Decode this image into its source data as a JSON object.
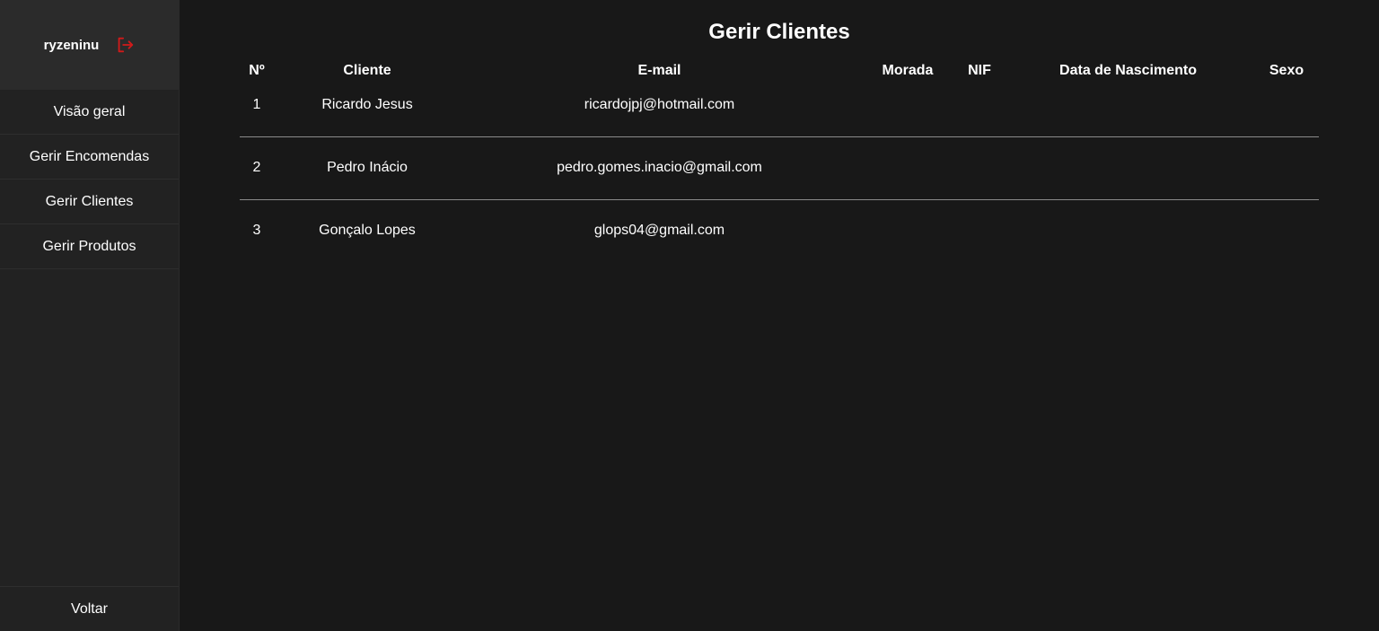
{
  "sidebar": {
    "username": "ryzeninu",
    "logout_icon": "logout-icon",
    "accent_color": "#d11a1a",
    "items": [
      {
        "label": "Visão geral"
      },
      {
        "label": "Gerir Encomendas"
      },
      {
        "label": "Gerir Clientes"
      },
      {
        "label": "Gerir Produtos"
      }
    ],
    "back_label": "Voltar"
  },
  "main": {
    "title": "Gerir Clientes",
    "table": {
      "headers": [
        "Nº",
        "Cliente",
        "E-mail",
        "Morada",
        "NIF",
        "Data de Nascimento",
        "Sexo"
      ],
      "rows": [
        {
          "num": "1",
          "cliente": "Ricardo Jesus",
          "email": "ricardojpj@hotmail.com",
          "morada": "",
          "nif": "",
          "data_nascimento": "",
          "sexo": ""
        },
        {
          "num": "2",
          "cliente": "Pedro Inácio",
          "email": "pedro.gomes.inacio@gmail.com",
          "morada": "",
          "nif": "",
          "data_nascimento": "",
          "sexo": ""
        },
        {
          "num": "3",
          "cliente": "Gonçalo Lopes",
          "email": "glops04@gmail.com",
          "morada": "",
          "nif": "",
          "data_nascimento": "",
          "sexo": ""
        }
      ]
    }
  }
}
